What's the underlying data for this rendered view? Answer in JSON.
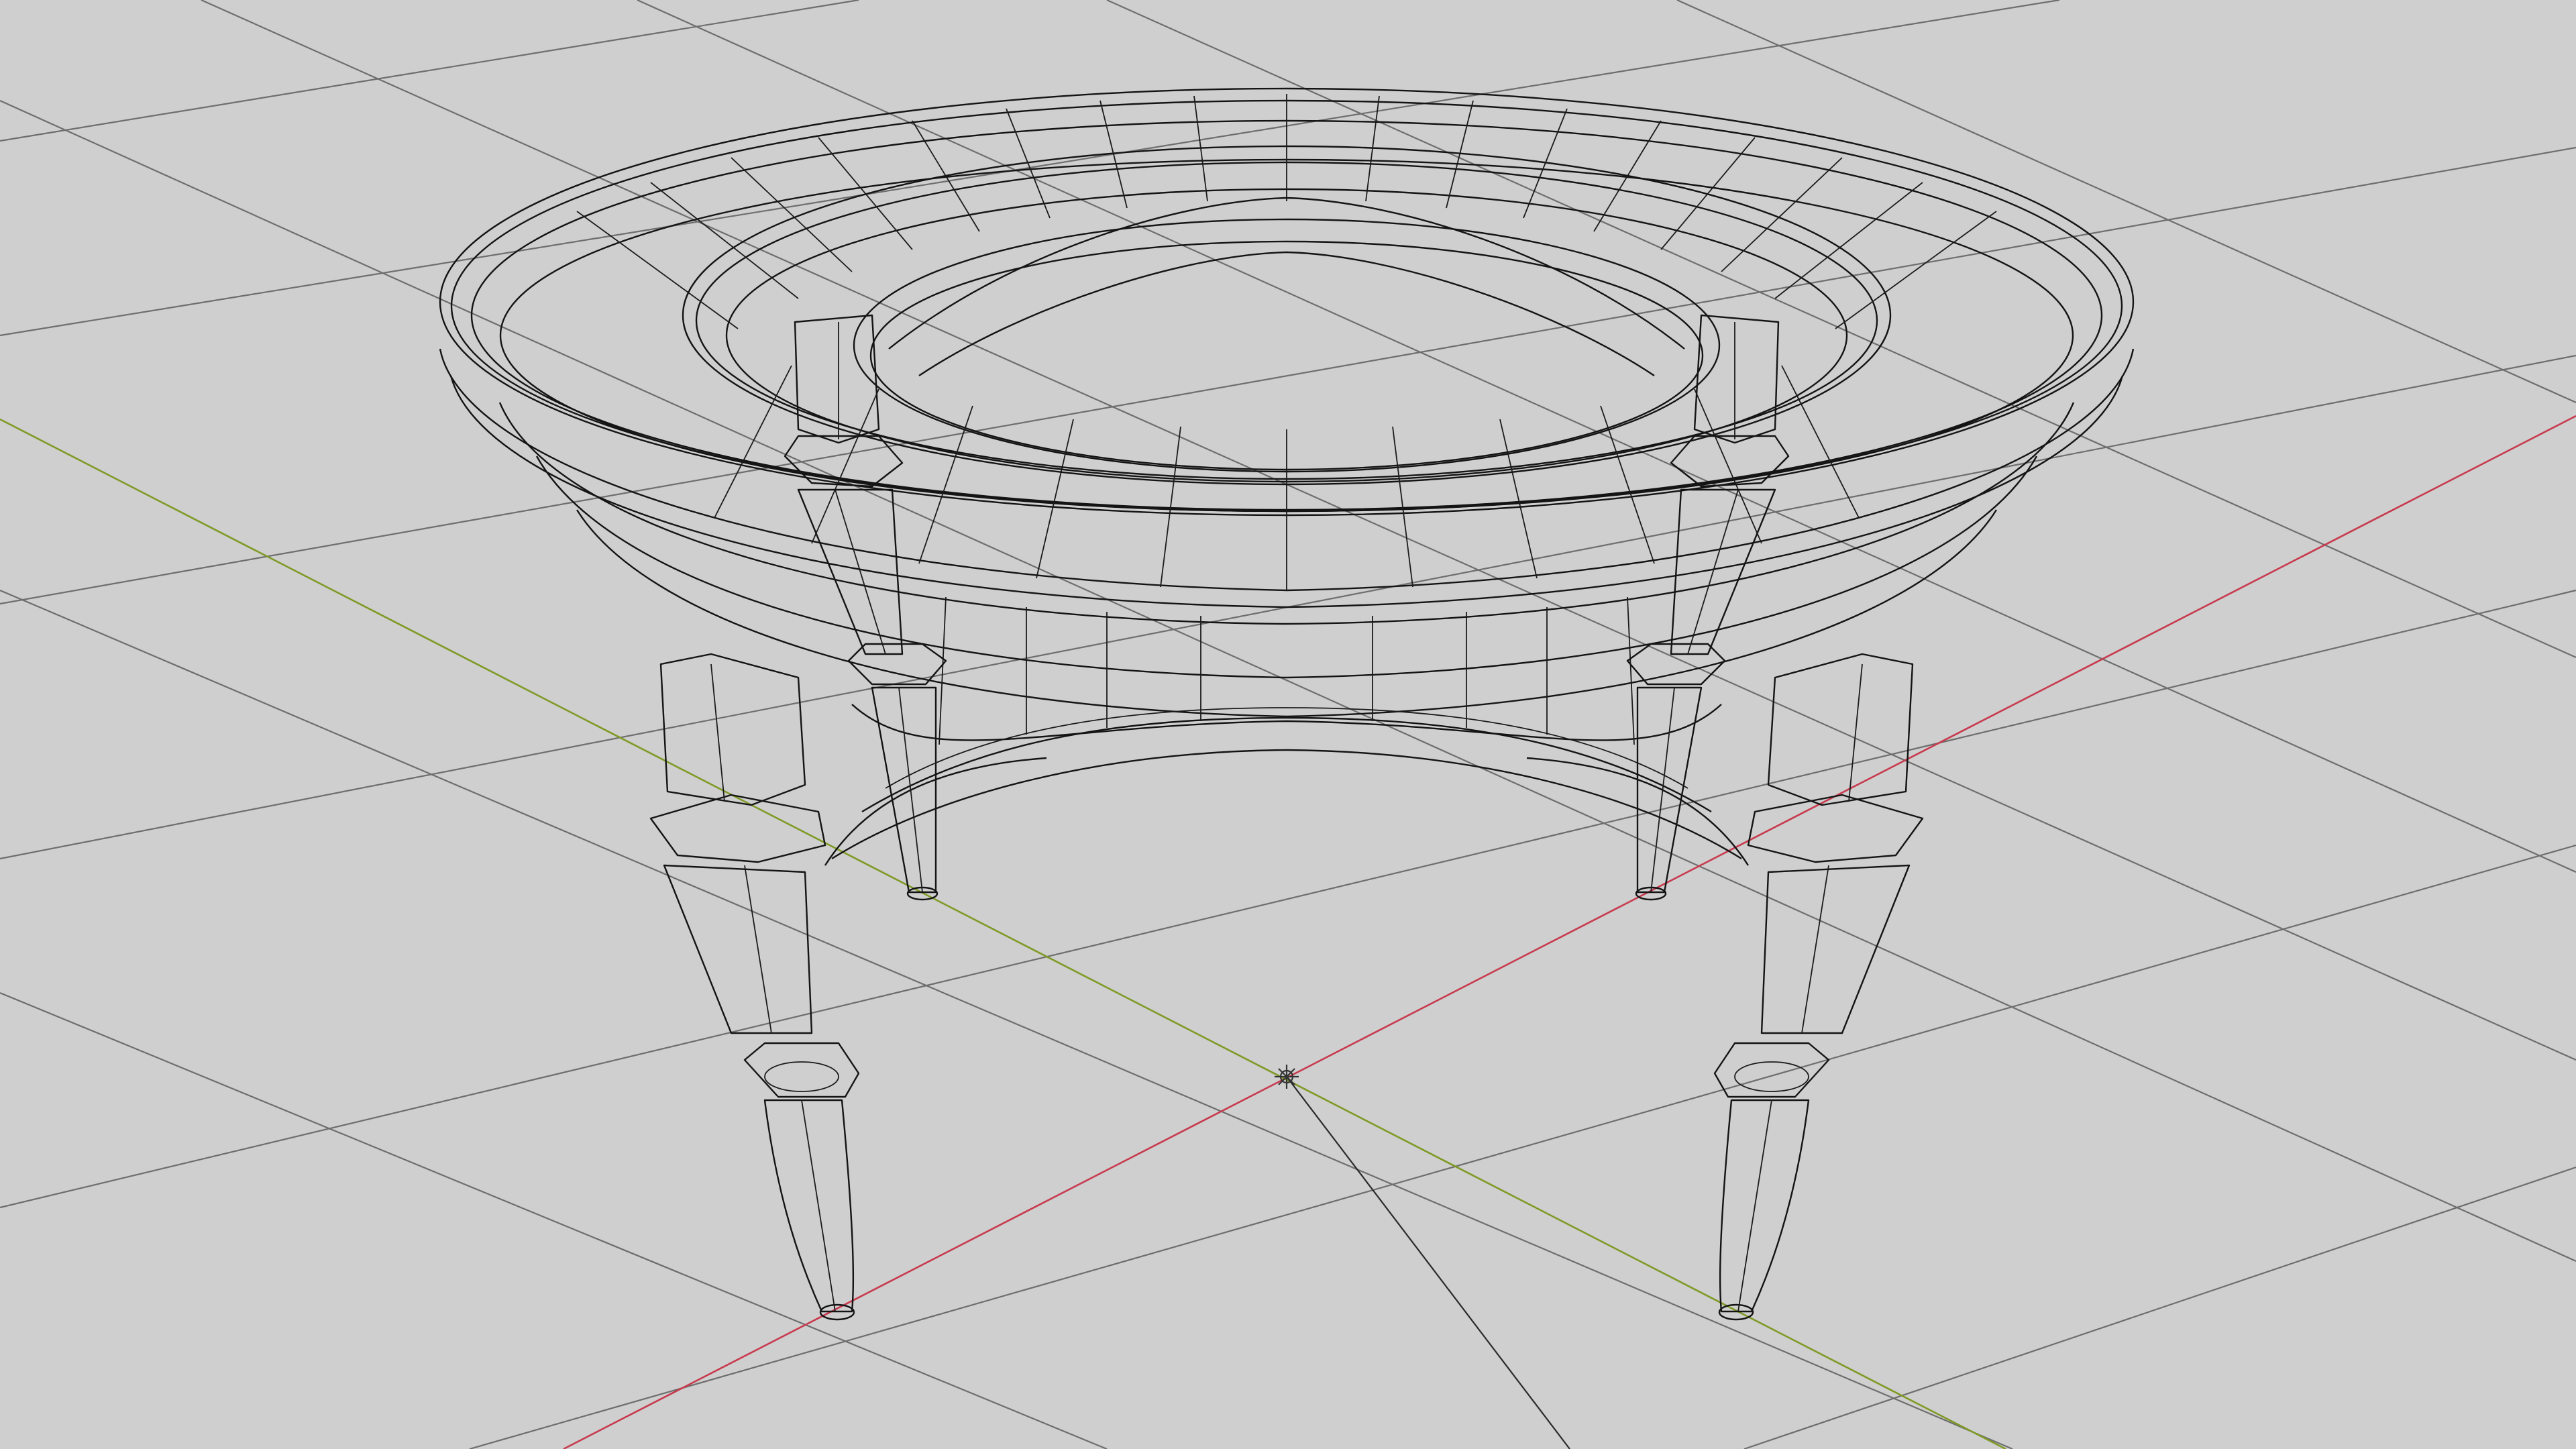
{
  "viewport": {
    "name": "3D Viewport",
    "shading": "wireframe",
    "background_color": "#cfcfcf",
    "grid_color": "#6e6e6e",
    "axis_x_color": "#c83a4e",
    "axis_y_color": "#7f9a26",
    "wire_color": "#141414"
  },
  "object": {
    "kind": "round table",
    "legs": 4
  }
}
